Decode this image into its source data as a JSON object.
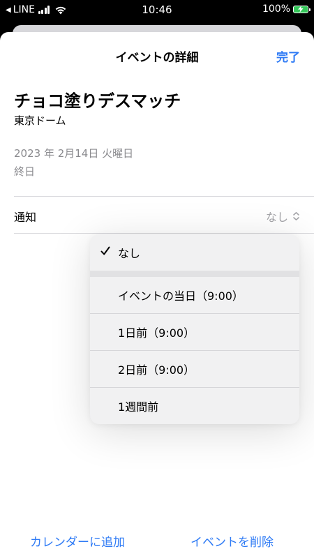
{
  "status_bar": {
    "carrier": "LINE",
    "time": "10:46",
    "battery": "100%",
    "back_glyph": "◀"
  },
  "sheet": {
    "title": "イベントの詳細",
    "done": "完了"
  },
  "event": {
    "title": "チョコ塗りデスマッチ",
    "location": "東京ドーム",
    "date": "2023 年 2月14日 火曜日",
    "all_day": "終日"
  },
  "notification": {
    "label": "通知",
    "value": "なし"
  },
  "menu": {
    "items": [
      {
        "label": "なし",
        "selected": true
      },
      {
        "label": "イベントの当日（9:00）",
        "selected": false
      },
      {
        "label": "1日前（9:00）",
        "selected": false
      },
      {
        "label": "2日前（9:00）",
        "selected": false
      },
      {
        "label": "1週間前",
        "selected": false
      }
    ]
  },
  "toolbar": {
    "add_to_calendar": "カレンダーに追加",
    "delete_event": "イベントを削除"
  },
  "colors": {
    "accent": "#2f7bf5",
    "battery": "#34c759",
    "secondary_text": "#8a8a8e"
  }
}
